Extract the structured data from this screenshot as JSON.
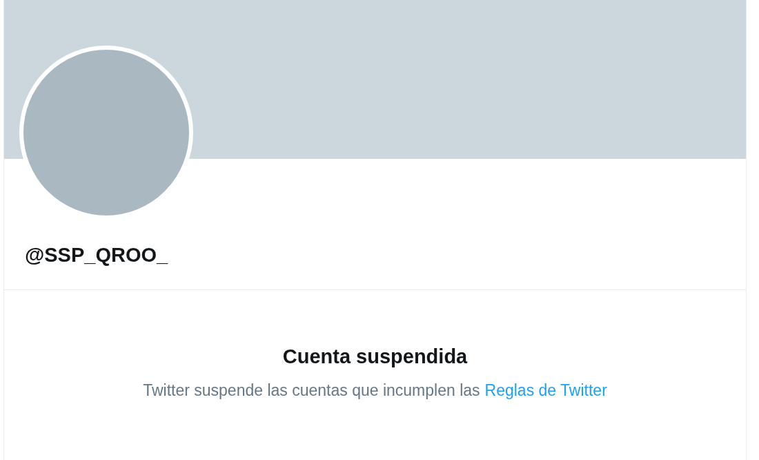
{
  "profile": {
    "handle": "@SSP_QROO_"
  },
  "notice": {
    "title": "Cuenta suspendida",
    "text": "Twitter suspende las cuentas que incumplen las",
    "link": "Reglas de Twitter"
  }
}
